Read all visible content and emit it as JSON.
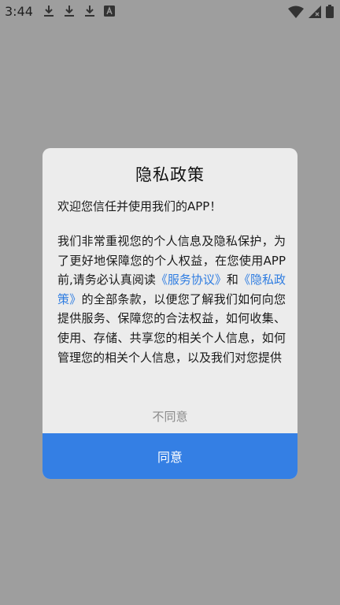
{
  "status_bar": {
    "time": "3:44",
    "left_icons": [
      "download-icon",
      "download-icon",
      "download-icon",
      "text-a-icon"
    ],
    "right_icons": [
      "wifi-icon",
      "cellular-signal-icon",
      "battery-icon"
    ]
  },
  "dialog": {
    "title": "隐私政策",
    "welcome": "欢迎您信任并使用我们的APP！",
    "body_parts": {
      "intro": " 我们非常重视您的个人信息及隐私保护，为了更好地保障您的个人权益，在您使用APP前,请务必认真阅读",
      "link_service": "《服务协议》",
      "connector": "和",
      "link_privacy": "《隐私政策》",
      "rest": "的全部条款，以便您了解我们如何向您提供服务、保障您的合法权益，如何收集、使用、存储、共享您的相关个人信息，如何管理您的相关个人信息，以及我们对您提供"
    },
    "link_color": "#2f7de1",
    "disagree_label": "不同意",
    "agree_label": "同意",
    "agree_color": "#347fe4"
  }
}
